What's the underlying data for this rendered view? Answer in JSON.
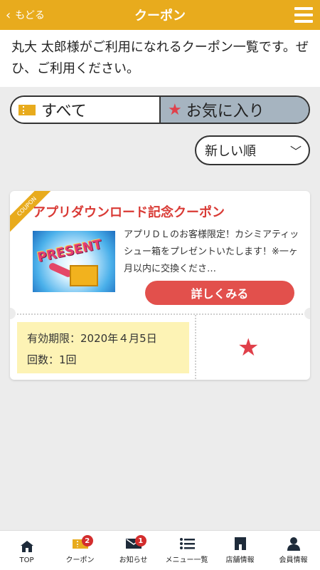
{
  "header": {
    "back_label": "もどる",
    "title": "クーポン"
  },
  "intro_text": "丸大 太郎様がご利用になれるクーポン一覧です。ぜひ、ご利用ください。",
  "filter": {
    "all_label": "すべて",
    "fav_label": "お気に入り"
  },
  "sort": {
    "selected": "新しい順"
  },
  "coupon": {
    "ribbon": "COUPON",
    "title": "アプリダウンロード記念クーポン",
    "image_text": "PRESENT",
    "description": "アプリＤＬのお客様限定！カシミアティッシュー箱をプレゼントいたします！※一ヶ月以内に交換くださ…",
    "detail_button": "詳しくみる",
    "expiry": "有効期限：2020年４月5日",
    "count": "回数：1回",
    "favorite": true
  },
  "tabbar": {
    "items": [
      {
        "label": "TOP",
        "icon": "home-icon"
      },
      {
        "label": "クーポン",
        "icon": "ticket-icon",
        "badge": "2"
      },
      {
        "label": "お知らせ",
        "icon": "mail-icon",
        "badge": "1"
      },
      {
        "label": "メニュー一覧",
        "icon": "list-icon"
      },
      {
        "label": "店舗情報",
        "icon": "store-icon"
      },
      {
        "label": "会員情報",
        "icon": "person-icon"
      }
    ]
  },
  "colors": {
    "header": "#e8ab1d",
    "accent_red": "#e2504c",
    "fav_segment": "#a6b4c0",
    "expiry_bg": "#fdf3b5"
  }
}
